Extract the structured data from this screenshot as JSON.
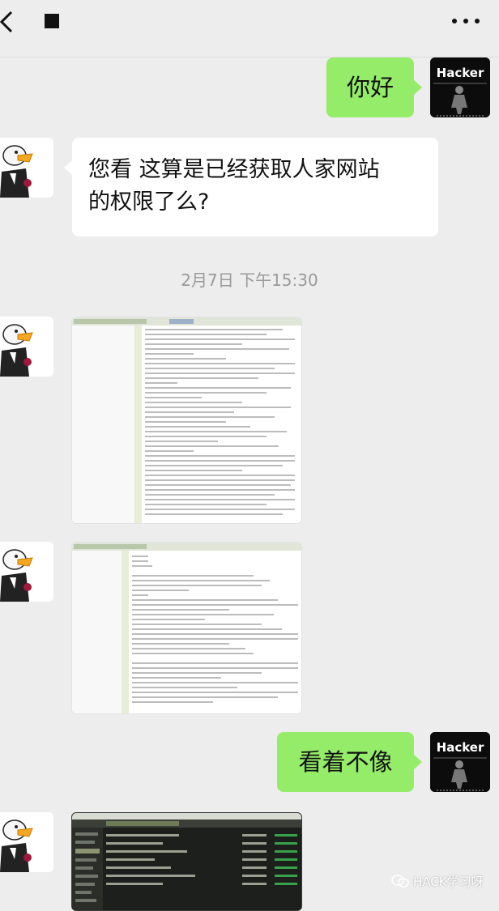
{
  "header": {
    "back_icon": "chevron-left-icon",
    "stop_icon": "square-icon",
    "more_icon": "ellipsis-icon"
  },
  "messages": [
    {
      "sender": "me",
      "text": "你好",
      "avatar": "Hacker"
    },
    {
      "sender": "them",
      "line1": "您看 这算是已经获取人家网站",
      "line2": "的权限了么?"
    },
    {
      "sender": "them",
      "type": "image",
      "description": "code-editor-screenshot"
    },
    {
      "sender": "them",
      "type": "image",
      "description": "code-editor-screenshot"
    },
    {
      "sender": "me",
      "text": "看着不像",
      "avatar": "Hacker"
    },
    {
      "sender": "them",
      "type": "image",
      "description": "dark-file-manager-screenshot"
    }
  ],
  "timestamp": "2月7日 下午15:30",
  "watermark": "HACK学习呀",
  "colors": {
    "background": "#ededed",
    "my_bubble": "#95ec69",
    "their_bubble": "#ffffff",
    "timestamp_text": "#9a9a9a"
  }
}
